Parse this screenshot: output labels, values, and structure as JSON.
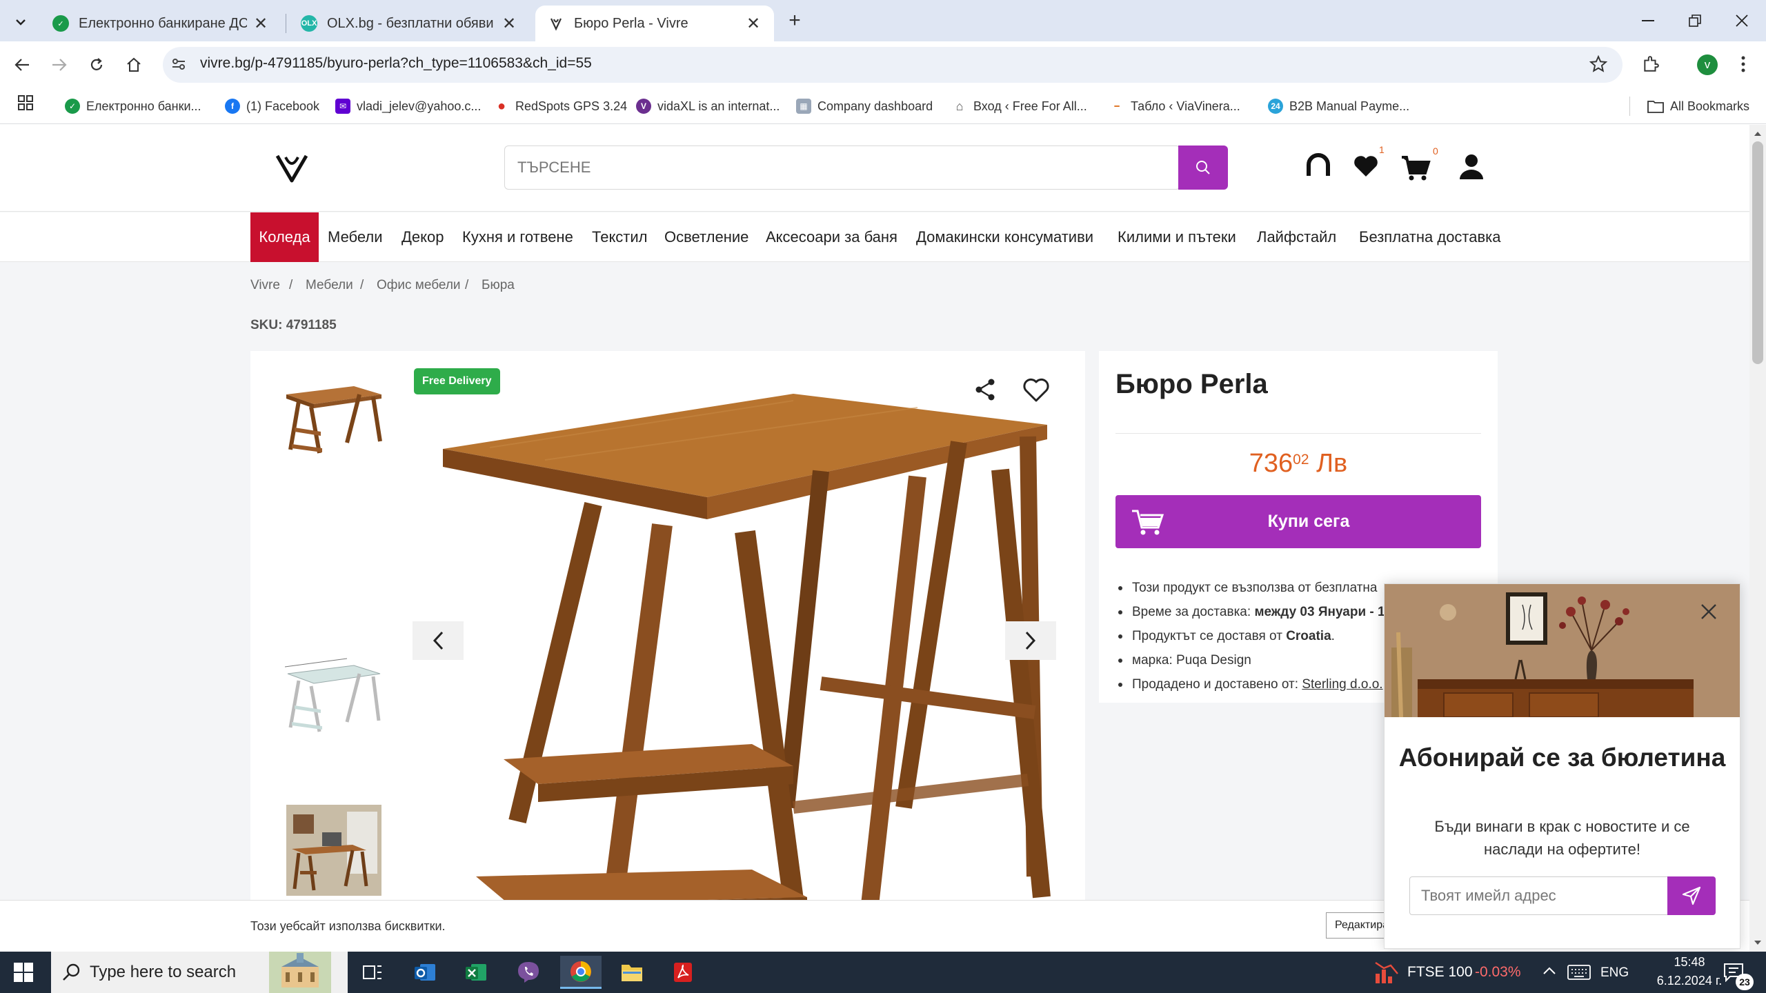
{
  "browser": {
    "tabs": [
      {
        "title": "Електронно банкиране ДСК Д",
        "color": "#1a9a4a",
        "close": "✕"
      },
      {
        "title": "OLX.bg - безплатни обяви",
        "color": "#23b6a8",
        "close": "✕"
      },
      {
        "title": "Бюро Perla - Vivre",
        "color": "#333333",
        "close": "✕"
      }
    ],
    "new_tab": "+",
    "url": "vivre.bg/p-4791185/byuro-perla?ch_type=1106583&ch_id=55",
    "profile_initial": "v",
    "bookmarks": [
      {
        "label": "Електронно банки...",
        "color": "#1a9a4a"
      },
      {
        "label": "(1) Facebook",
        "color": "#1877f2"
      },
      {
        "label": "vladi_jelev@yahoo.c...",
        "color": "#6001d2"
      },
      {
        "label": "RedSpots GPS 3.24",
        "color": "#d93025"
      },
      {
        "label": "vidaXL is an internat...",
        "color": "#6b2f8f"
      },
      {
        "label": "Company dashboard",
        "color": "#9aa7b8"
      },
      {
        "label": "Вход ‹ Free For All...",
        "color": "#555555"
      },
      {
        "label": "Табло ‹ ViaVinera...",
        "color": "#e07a2c"
      },
      {
        "label": "B2B Manual Payme...",
        "color": "#2aa3d9"
      }
    ],
    "all_bookmarks": "All Bookmarks"
  },
  "site": {
    "search_placeholder": "ТЪРСЕНЕ",
    "wishlist_count": "1",
    "cart_count": "0",
    "categories": [
      "Коледа",
      "Мебели",
      "Декор",
      "Кухня и готвене",
      "Текстил",
      "Осветление",
      "Аксесоари за баня",
      "Домакински консумативи",
      "Килими и пътеки",
      "Лайфстайл",
      "Безплатна доставка"
    ],
    "breadcrumb": [
      "Vivre",
      "Мебели",
      "Офис мебели",
      "Бюра"
    ],
    "breadcrumb_sep": "/"
  },
  "product": {
    "sku_label": "SKU: 4791185",
    "badge": "Free Delivery",
    "title": "Бюро Perla",
    "price_main": "736",
    "price_cents": "02",
    "price_currency": "Лв",
    "buy_label": "Купи сега",
    "bullets": {
      "b1": "Този продукт се възползва от безплатна",
      "b2_pre": "Време за доставка: ",
      "b2_bold": "между 03 Януари - 1",
      "b3_pre": "Продуктът се доставя от ",
      "b3_bold": "Croatia",
      "b3_post": ".",
      "b4": "марка: Puqa Design",
      "b5_pre": "Продадено и доставено от: ",
      "b5_link": "Sterling d.o.o."
    }
  },
  "cookie": {
    "text": "Този уебсайт използва бисквитки.",
    "edit_button": "Редактира"
  },
  "newsletter": {
    "title": "Абонирай се за бюлетина",
    "subtitle": "Бъди винаги в крак с новостите и се наслади на офертите!",
    "email_placeholder": "Твоят имейл адрес"
  },
  "taskbar": {
    "search_placeholder": "Type here to search",
    "ticker": "FTSE 100",
    "ticker_change": "-0.03%",
    "language": "ENG",
    "time": "15:48",
    "date": "6.12.2024 г.",
    "notifications": "23"
  },
  "colors": {
    "brand": "#a42eb9",
    "price": "#e06020",
    "active_category": "#c8102e",
    "free_badge": "#2eac4a"
  }
}
